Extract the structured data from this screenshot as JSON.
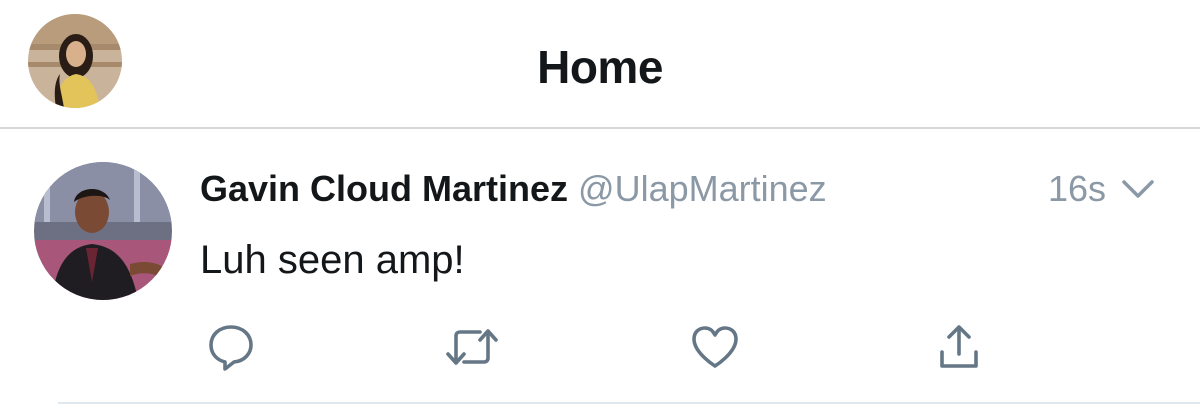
{
  "header": {
    "title": "Home",
    "profile_avatar_icon": "profile-photo"
  },
  "tweet": {
    "display_name": "Gavin Cloud Martinez",
    "handle": "@UlapMartinez",
    "time": "16s",
    "text": "Luh seen amp!",
    "avatar_icon": "user-photo"
  },
  "actions": [
    {
      "name": "reply",
      "icon": "speech-bubble-icon"
    },
    {
      "name": "retweet",
      "icon": "retweet-arrows-icon"
    },
    {
      "name": "like",
      "icon": "heart-icon"
    },
    {
      "name": "share",
      "icon": "share-upload-icon"
    }
  ],
  "colors": {
    "text_primary": "#14171a",
    "text_secondary": "#8b98a5",
    "divider": "#d6d9dc",
    "icon": "#657786"
  }
}
